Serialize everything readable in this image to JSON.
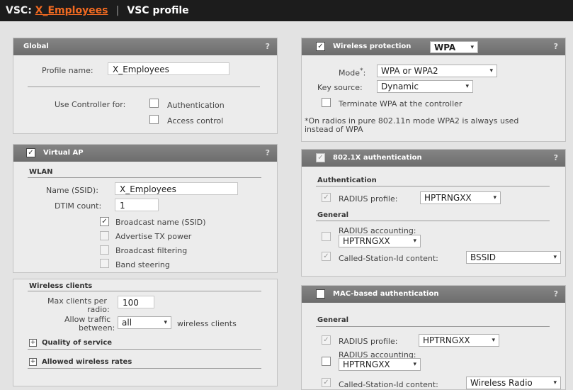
{
  "titlebar": {
    "prefix": "VSC:",
    "vsc_name": "X_Employees",
    "separator": "|",
    "page": "VSC profile"
  },
  "global": {
    "title": "Global",
    "help": "?",
    "profile_name_label": "Profile name:",
    "profile_name": "X_Employees",
    "use_controller_label": "Use Controller for:",
    "authentication_label": "Authentication",
    "access_control_label": "Access control"
  },
  "virtual_ap": {
    "title": "Virtual AP",
    "help": "?",
    "checked": "✓",
    "wlan_label": "WLAN",
    "ssid_label": "Name (SSID):",
    "ssid": "X_Employees",
    "dtim_label": "DTIM count:",
    "dtim": "1",
    "broadcast_name_label": "Broadcast name (SSID)",
    "broadcast_name_checked": "✓",
    "advertise_tx_label": "Advertise TX power",
    "broadcast_filtering_label": "Broadcast filtering",
    "band_steering_label": "Band steering"
  },
  "wireless_clients": {
    "title": "Wireless clients",
    "max_clients_label_1": "Max clients per",
    "max_clients_label_2": "radio:",
    "max_clients": "100",
    "allow_traffic_label_1": "Allow traffic",
    "allow_traffic_label_2": "between:",
    "allow_traffic": "all",
    "wireless_clients_suffix": "wireless clients",
    "quality_of_service": "Quality of service",
    "allowed_rates": "Allowed wireless rates",
    "expand_glyph": "+"
  },
  "wireless_protection": {
    "title": "Wireless protection",
    "help": "?",
    "checked": "✓",
    "type": "WPA",
    "mode_label": "Mode",
    "mode_star": "*",
    "mode_colon": ":",
    "mode": "WPA or WPA2",
    "key_source_label": "Key source:",
    "key_source": "Dynamic",
    "terminate_label": "Terminate WPA at the controller",
    "note_1": "*On radios in pure 802.11n mode WPA2 is always used",
    "note_2": "instead of WPA"
  },
  "dot1x": {
    "title": "802.1X authentication",
    "help": "?",
    "checked": "✓",
    "auth_section": "Authentication",
    "radius_profile_label": "RADIUS profile:",
    "radius_profile_checked": "✓",
    "radius_profile": "HPTRNGXX",
    "general_section": "General",
    "radius_accounting_label": "RADIUS accounting:",
    "radius_accounting": "HPTRNGXX",
    "called_station_label": "Called-Station-Id content:",
    "called_station_checked": "✓",
    "called_station": "BSSID"
  },
  "mac_auth": {
    "title": "MAC-based authentication",
    "help": "?",
    "general_section": "General",
    "radius_profile_label": "RADIUS profile:",
    "radius_profile_checked": "✓",
    "radius_profile": "HPTRNGXX",
    "radius_accounting_label": "RADIUS accounting:",
    "radius_accounting": "HPTRNGXX",
    "called_station_label": "Called-Station-Id content:",
    "called_station_checked": "✓",
    "called_station": "Wireless Radio"
  },
  "dropdown_arrow": "▾"
}
